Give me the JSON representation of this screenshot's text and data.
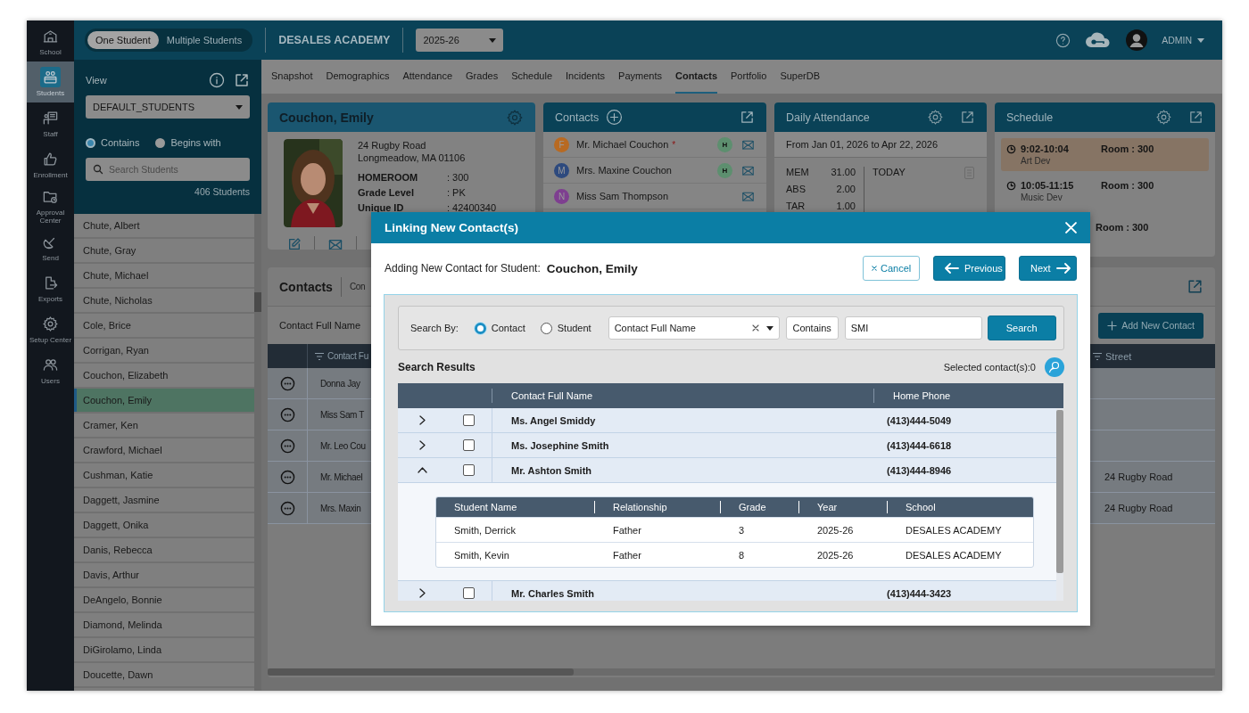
{
  "rail": [
    {
      "label": "School",
      "selected": false
    },
    {
      "label": "Students",
      "selected": true
    },
    {
      "label": "Staff",
      "selected": false
    },
    {
      "label": "Enrollment",
      "selected": false
    },
    {
      "label": "Approval Center",
      "selected": false
    },
    {
      "label": "Send",
      "selected": false
    },
    {
      "label": "Exports",
      "selected": false
    },
    {
      "label": "Setup Center",
      "selected": false
    },
    {
      "label": "Users",
      "selected": false
    }
  ],
  "topbar": {
    "mode_toggle": [
      {
        "label": "One Student",
        "selected": true
      },
      {
        "label": "Multiple Students",
        "selected": false
      }
    ],
    "school": "DESALES ACADEMY",
    "year": "2025-26",
    "user": "ADMIN"
  },
  "student_panel": {
    "view_label": "View",
    "view": "DEFAULT_STUDENTS",
    "match": [
      {
        "label": "Contains",
        "selected": true
      },
      {
        "label": "Begins with",
        "selected": false
      }
    ],
    "search_placeholder": "Search Students",
    "count": "406 Students",
    "students": [
      {
        "name": "Chute, Albert",
        "selected": false
      },
      {
        "name": "Chute, Gray",
        "selected": false
      },
      {
        "name": "Chute, Michael",
        "selected": false
      },
      {
        "name": "Chute, Nicholas",
        "selected": false
      },
      {
        "name": "Cole, Brice",
        "selected": false
      },
      {
        "name": "Corrigan, Ryan",
        "selected": false
      },
      {
        "name": "Couchon, Elizabeth",
        "selected": false
      },
      {
        "name": "Couchon, Emily",
        "selected": true
      },
      {
        "name": "Cramer, Ken",
        "selected": false
      },
      {
        "name": "Crawford, Michael",
        "selected": false
      },
      {
        "name": "Cushman, Katie",
        "selected": false
      },
      {
        "name": "Daggett, Jasmine",
        "selected": false
      },
      {
        "name": "Daggett, Onika",
        "selected": false
      },
      {
        "name": "Danis, Rebecca",
        "selected": false
      },
      {
        "name": "Davis, Arthur",
        "selected": false
      },
      {
        "name": "DeAngelo, Bonnie",
        "selected": false
      },
      {
        "name": "Diamond, Melinda",
        "selected": false
      },
      {
        "name": "DiGirolamo, Linda",
        "selected": false
      },
      {
        "name": "Doucette, Dawn",
        "selected": false
      }
    ]
  },
  "tabs": [
    {
      "label": "Snapshot",
      "selected": false
    },
    {
      "label": "Demographics",
      "selected": false
    },
    {
      "label": "Attendance",
      "selected": false
    },
    {
      "label": "Grades",
      "selected": false
    },
    {
      "label": "Schedule",
      "selected": false
    },
    {
      "label": "Incidents",
      "selected": false
    },
    {
      "label": "Payments",
      "selected": false
    },
    {
      "label": "Contacts",
      "selected": true
    },
    {
      "label": "Portfolio",
      "selected": false
    },
    {
      "label": "SuperDB",
      "selected": false
    }
  ],
  "student_card": {
    "name": "Couchon, Emily",
    "address": [
      "24 Rugby Road",
      "Longmeadow, MA 01106"
    ],
    "fields": [
      {
        "label": "HOMEROOM",
        "value": ": 300"
      },
      {
        "label": "Grade Level",
        "value": ": PK"
      },
      {
        "label": "Unique ID",
        "value": ": 42400340"
      }
    ]
  },
  "contacts_card": {
    "title": "Contacts",
    "items": [
      {
        "initial": "F",
        "name": "Mr. Michael Couchon",
        "mark": "*",
        "badge": "H",
        "color": "#b86a22"
      },
      {
        "initial": "M",
        "name": "Mrs. Maxine Couchon",
        "badge": "H",
        "color": "#2e4a7e"
      },
      {
        "initial": "N",
        "name": "Miss Sam Thompson",
        "color": "#7e3f90"
      }
    ]
  },
  "attendance": {
    "title": "Daily Attendance",
    "range": "From Jan 01, 2026 to Apr 22, 2026",
    "stats": [
      {
        "label": "MEM",
        "value": "31.00"
      },
      {
        "label": "ABS",
        "value": "2.00"
      },
      {
        "label": "TAR",
        "value": "1.00"
      }
    ],
    "today": "TODAY"
  },
  "schedule": {
    "title": "Schedule",
    "items": [
      {
        "time": "9:02-10:04",
        "course": "Art Dev",
        "room": "Room : 300",
        "highlight": true
      },
      {
        "time": "10:05-11:15",
        "course": "Music Dev",
        "room": "Room : 300",
        "highlight": false
      },
      {
        "room": "Room : 300",
        "highlight": false
      }
    ]
  },
  "contacts_panel": {
    "title": "Contacts",
    "tab_2": "Con",
    "filter_label": "Contact Full Name",
    "add_button": "Add New Contact",
    "columns": [
      "Contact Fu",
      "Street"
    ],
    "rows": [
      {
        "name": "Donna Jay"
      },
      {
        "name": "Miss Sam T"
      },
      {
        "name": "Mr. Leo Cou"
      },
      {
        "name": "Mr. Michael",
        "street": "24 Rugby Road"
      },
      {
        "name": "Mrs. Maxin",
        "street": "24 Rugby Road"
      }
    ]
  },
  "modal": {
    "title": "Linking New Contact(s)",
    "student_label": "Adding New Contact for Student:",
    "student": "Couchon, Emily",
    "buttons": {
      "cancel": "Cancel",
      "previous": "Previous",
      "next": "Next"
    },
    "search": {
      "by_label": "Search By:",
      "by": [
        {
          "label": "Contact",
          "selected": true
        },
        {
          "label": "Student",
          "selected": false
        }
      ],
      "field": "Contact Full Name",
      "operator": "Contains",
      "query": "SMI",
      "button": "Search"
    },
    "results": {
      "title": "Search Results",
      "selected_count": "Selected contact(s):0",
      "columns": [
        "Contact Full Name",
        "Home Phone"
      ],
      "rows": [
        {
          "name": "Ms. Angel Smiddy",
          "phone": "(413)444-5049",
          "checked": false,
          "expanded": false
        },
        {
          "name": "Ms. Josephine Smith",
          "phone": "(413)444-6618",
          "checked": false,
          "expanded": false
        },
        {
          "name": "Mr. Ashton Smith",
          "phone": "(413)444-8946",
          "checked": false,
          "expanded": true,
          "students": {
            "columns": [
              "Student Name",
              "Relationship",
              "Grade",
              "Year",
              "School"
            ],
            "rows": [
              [
                "Smith, Derrick",
                "Father",
                "3",
                "2025-26",
                "DESALES ACADEMY"
              ],
              [
                "Smith, Kevin",
                "Father",
                "8",
                "2025-26",
                "DESALES ACADEMY"
              ]
            ]
          }
        },
        {
          "name": "Mr. Charles Smith",
          "phone": "(413)444-3423",
          "checked": false,
          "expanded": false
        }
      ]
    }
  }
}
